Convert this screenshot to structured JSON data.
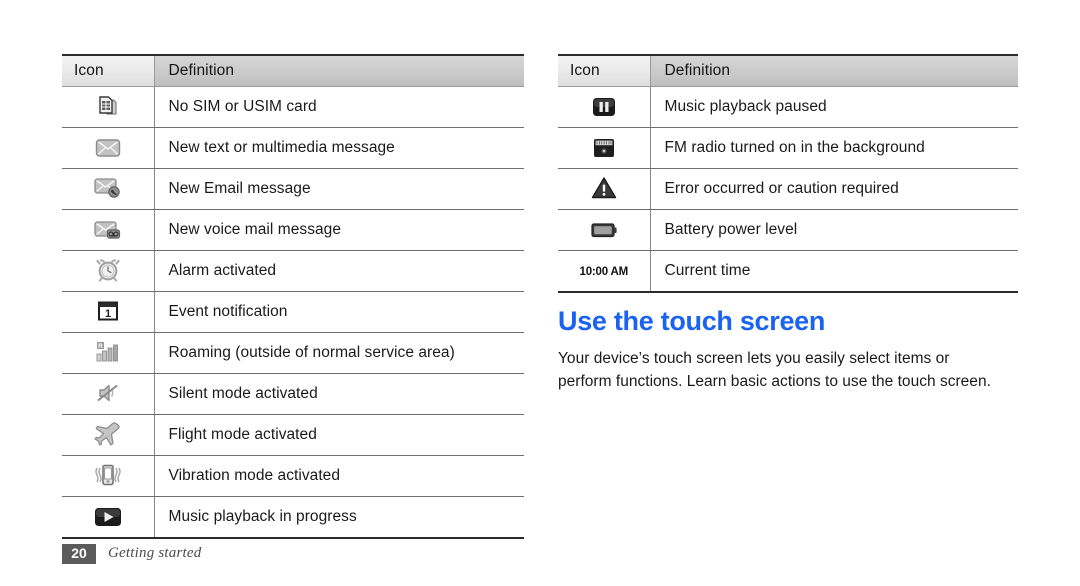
{
  "document": {
    "footer": {
      "page_number": "20",
      "section_label": "Getting started"
    }
  },
  "tables": {
    "left": {
      "headers": {
        "icon": "Icon",
        "definition": "Definition"
      },
      "rows": [
        {
          "icon_name": "sim-card-icon",
          "definition": "No SIM or USIM card"
        },
        {
          "icon_name": "new-message-icon",
          "definition": "New text or multimedia message"
        },
        {
          "icon_name": "new-email-icon",
          "definition": "New Email message"
        },
        {
          "icon_name": "new-voicemail-icon",
          "definition": "New voice mail message"
        },
        {
          "icon_name": "alarm-clock-icon",
          "definition": "Alarm activated"
        },
        {
          "icon_name": "calendar-event-icon",
          "definition": "Event notification"
        },
        {
          "icon_name": "roaming-signal-icon",
          "definition": "Roaming (outside of normal service area)"
        },
        {
          "icon_name": "silent-mute-icon",
          "definition": "Silent mode activated"
        },
        {
          "icon_name": "airplane-icon",
          "definition": "Flight mode activated"
        },
        {
          "icon_name": "vibration-icon",
          "definition": "Vibration mode activated"
        },
        {
          "icon_name": "play-icon",
          "definition": "Music playback in progress"
        }
      ]
    },
    "right": {
      "headers": {
        "icon": "Icon",
        "definition": "Definition"
      },
      "rows": [
        {
          "icon_name": "pause-icon",
          "definition": "Music playback paused"
        },
        {
          "icon_name": "fm-radio-icon",
          "definition": "FM radio turned on in the background"
        },
        {
          "icon_name": "warning-triangle-icon",
          "definition": "Error occurred or caution required"
        },
        {
          "icon_name": "battery-icon",
          "definition": "Battery power level"
        },
        {
          "icon_name": "current-time-text",
          "icon_text": "10:00 AM",
          "definition": "Current time"
        }
      ]
    }
  },
  "section": {
    "title": "Use the touch screen",
    "body": "Your device’s touch screen lets you easily select items or perform functions. Learn basic actions to use the touch screen."
  },
  "colors": {
    "heading_blue": "#1a62f0",
    "page_badge_gray": "#5b5b5b",
    "rule_dark": "#2b2b2b"
  }
}
